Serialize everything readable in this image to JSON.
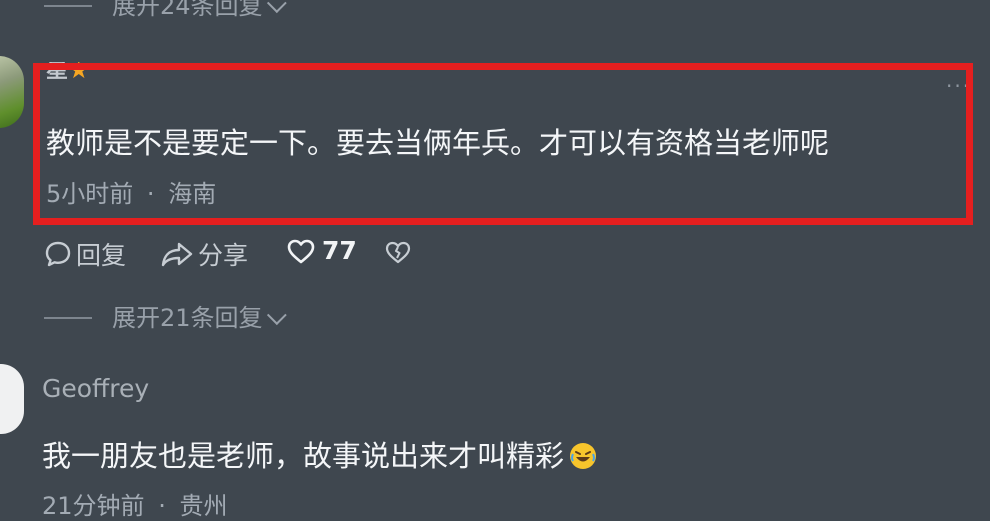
{
  "top_expand": {
    "label": "展开24条回复"
  },
  "comment1": {
    "username": "星",
    "text": "教师是不是要定一下。要去当俩年兵。才可以有资格当老师呢",
    "time": "5小时前",
    "location": "海南",
    "separator": "·",
    "more": "···"
  },
  "actions": {
    "reply_label": "回复",
    "share_label": "分享",
    "like_count": "77"
  },
  "middle_expand": {
    "label": "展开21条回复"
  },
  "comment2": {
    "username": "Geoffrey",
    "text": "我一朋友也是老师，故事说出来才叫精彩",
    "time": "21分钟前",
    "location": "贵州",
    "separator": "·"
  },
  "colors": {
    "background": "#3f474f",
    "highlight": "#e51f1f",
    "badge": "#f5a623"
  }
}
